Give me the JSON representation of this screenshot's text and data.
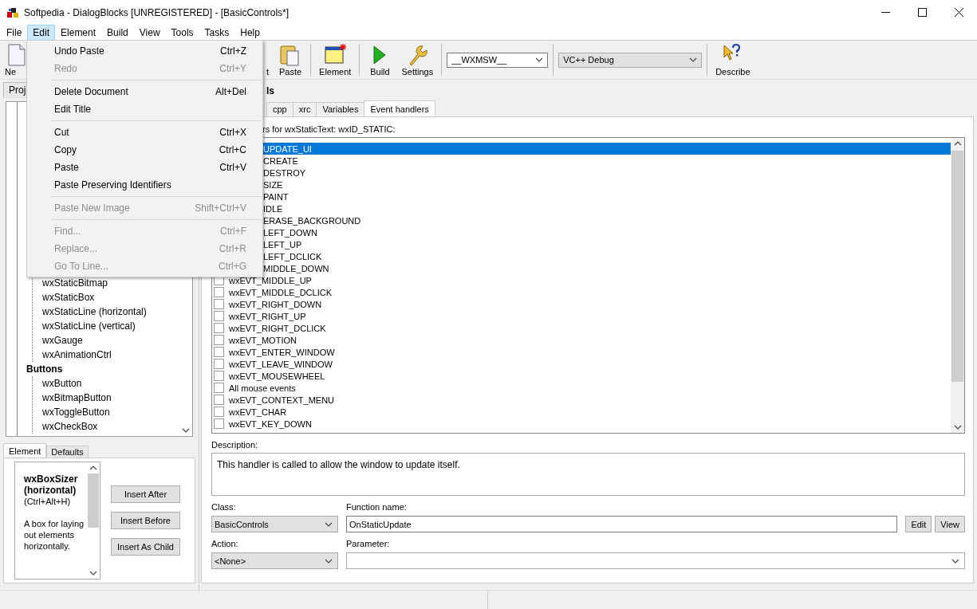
{
  "window": {
    "title": "Softpedia - DialogBlocks [UNREGISTERED] - [BasicControls*]"
  },
  "menubar": [
    {
      "label": "File",
      "selected": false
    },
    {
      "label": "Edit",
      "selected": true
    },
    {
      "label": "Element",
      "selected": false
    },
    {
      "label": "Build",
      "selected": false
    },
    {
      "label": "View",
      "selected": false
    },
    {
      "label": "Tools",
      "selected": false
    },
    {
      "label": "Tasks",
      "selected": false
    },
    {
      "label": "Help",
      "selected": false
    }
  ],
  "toolbar": [
    {
      "kind": "button",
      "label": "Ne"
    },
    {
      "kind": "hidden"
    },
    {
      "kind": "button",
      "label": "t"
    },
    {
      "kind": "button",
      "label": "Paste"
    },
    {
      "kind": "sep"
    },
    {
      "kind": "button",
      "label": "Element"
    },
    {
      "kind": "sep"
    },
    {
      "kind": "button",
      "label": "Build"
    },
    {
      "kind": "button",
      "label": "Settings"
    },
    {
      "kind": "sep"
    },
    {
      "kind": "combo",
      "value": "__WXMSW__",
      "disabled": false
    },
    {
      "kind": "sep"
    },
    {
      "kind": "combo",
      "value": "VC++ Debug",
      "disabled": true
    },
    {
      "kind": "sep"
    },
    {
      "kind": "button",
      "label": "Describe"
    }
  ],
  "left_panel": {
    "tab": "Proj",
    "tree": [
      {
        "children": [
          {
            "label": "wxStaticBitmap"
          },
          {
            "label": "wxStaticBox"
          },
          {
            "label": "wxStaticLine (horizontal)"
          },
          {
            "label": "wxStaticLine (vertical)"
          },
          {
            "label": "wxGauge"
          },
          {
            "label": "wxAnimationCtrl"
          }
        ]
      },
      {
        "label": "Buttons",
        "children": [
          {
            "label": "wxButton"
          },
          {
            "label": "wxBitmapButton"
          },
          {
            "label": "wxToggleButton"
          },
          {
            "label": "wxCheckBox"
          }
        ]
      }
    ],
    "element_tabs": [
      {
        "label": "Element",
        "selected": true
      },
      {
        "label": "Defaults",
        "selected": false
      }
    ],
    "element_info": {
      "name": "wxBoxSizer (horizontal)",
      "shortcut": "(Ctrl+Alt+H)",
      "description": "A box for laying out elements horizontally."
    },
    "buttons": [
      "Insert After",
      "Insert Before",
      "Insert As Child"
    ]
  },
  "editor": {
    "title": "ls",
    "tabs": [
      {
        "label": "cpp",
        "selected": false
      },
      {
        "label": "xrc",
        "selected": false
      },
      {
        "label": "Variables",
        "selected": false
      },
      {
        "label": "Event handlers",
        "selected": true
      }
    ],
    "list_label": "rs for wxStaticText: wxID_STATIC:",
    "events": [
      {
        "kind": "partial",
        "text": "UPDATE_UI",
        "selected": true
      },
      {
        "kind": "partial",
        "text": "CREATE",
        "selected": false
      },
      {
        "kind": "partial",
        "text": "DESTROY",
        "selected": false
      },
      {
        "kind": "partial",
        "text": "SIZE",
        "selected": false
      },
      {
        "kind": "partial",
        "text": "PAINT",
        "selected": false
      },
      {
        "kind": "partial",
        "text": "IDLE",
        "selected": false
      },
      {
        "kind": "partial",
        "text": "ERASE_BACKGROUND",
        "selected": false
      },
      {
        "kind": "partial",
        "text": "LEFT_DOWN",
        "selected": false
      },
      {
        "kind": "partial",
        "text": "LEFT_UP",
        "selected": false
      },
      {
        "kind": "partial",
        "text": "LEFT_DCLICK",
        "selected": false
      },
      {
        "kind": "partial",
        "text": "MIDDLE_DOWN",
        "selected": false
      },
      {
        "kind": "full",
        "text": "wxEVT_MIDDLE_UP",
        "checked": false,
        "selected": false
      },
      {
        "kind": "full",
        "text": "wxEVT_MIDDLE_DCLICK",
        "checked": false,
        "selected": false
      },
      {
        "kind": "full",
        "text": "wxEVT_RIGHT_DOWN",
        "checked": false,
        "selected": false
      },
      {
        "kind": "full",
        "text": "wxEVT_RIGHT_UP",
        "checked": false,
        "selected": false
      },
      {
        "kind": "full",
        "text": "wxEVT_RIGHT_DCLICK",
        "checked": false,
        "selected": false
      },
      {
        "kind": "full",
        "text": "wxEVT_MOTION",
        "checked": false,
        "selected": false
      },
      {
        "kind": "full",
        "text": "wxEVT_ENTER_WINDOW",
        "checked": false,
        "selected": false
      },
      {
        "kind": "full",
        "text": "wxEVT_LEAVE_WINDOW",
        "checked": false,
        "selected": false
      },
      {
        "kind": "full",
        "text": "wxEVT_MOUSEWHEEL",
        "checked": false,
        "selected": false
      },
      {
        "kind": "full",
        "text": "All mouse events",
        "checked": false,
        "selected": false
      },
      {
        "kind": "full",
        "text": "wxEVT_CONTEXT_MENU",
        "checked": false,
        "selected": false
      },
      {
        "kind": "full",
        "text": "wxEVT_CHAR",
        "checked": false,
        "selected": false
      },
      {
        "kind": "full",
        "text": "wxEVT_KEY_DOWN",
        "checked": false,
        "selected": false
      }
    ],
    "description_label": "Description:",
    "description": "This handler is called to allow the window to update itself.",
    "class_label": "Class:",
    "class_value": "BasicControls",
    "function_label": "Function name:",
    "function_value": "OnStaticUpdate",
    "function_buttons": [
      "Edit",
      "View"
    ],
    "action_label": "Action:",
    "action_value": "<None>",
    "parameter_label": "Parameter:"
  },
  "edit_menu": [
    {
      "kind": "item",
      "label": "Undo Paste",
      "shortcut": "Ctrl+Z",
      "disabled": false
    },
    {
      "kind": "item",
      "label": "Redo",
      "shortcut": "Ctrl+Y",
      "disabled": true
    },
    {
      "kind": "separator"
    },
    {
      "kind": "item",
      "label": "Delete Document",
      "shortcut": "Alt+Del",
      "disabled": false
    },
    {
      "kind": "item",
      "label": "Edit Title",
      "disabled": false
    },
    {
      "kind": "separator"
    },
    {
      "kind": "item",
      "label": "Cut",
      "shortcut": "Ctrl+X",
      "disabled": false
    },
    {
      "kind": "item",
      "label": "Copy",
      "shortcut": "Ctrl+C",
      "disabled": false
    },
    {
      "kind": "item",
      "label": "Paste",
      "shortcut": "Ctrl+V",
      "disabled": false
    },
    {
      "kind": "item",
      "label": "Paste Preserving Identifiers",
      "disabled": false
    },
    {
      "kind": "separator"
    },
    {
      "kind": "item",
      "label": "Paste New Image",
      "shortcut": "Shift+Ctrl+V",
      "disabled": true
    },
    {
      "kind": "separator"
    },
    {
      "kind": "item",
      "label": "Find...",
      "shortcut": "Ctrl+F",
      "disabled": true
    },
    {
      "kind": "item",
      "label": "Replace...",
      "shortcut": "Ctrl+R",
      "disabled": true
    },
    {
      "kind": "item",
      "label": "Go To Line...",
      "shortcut": "Ctrl+G",
      "disabled": true
    }
  ]
}
